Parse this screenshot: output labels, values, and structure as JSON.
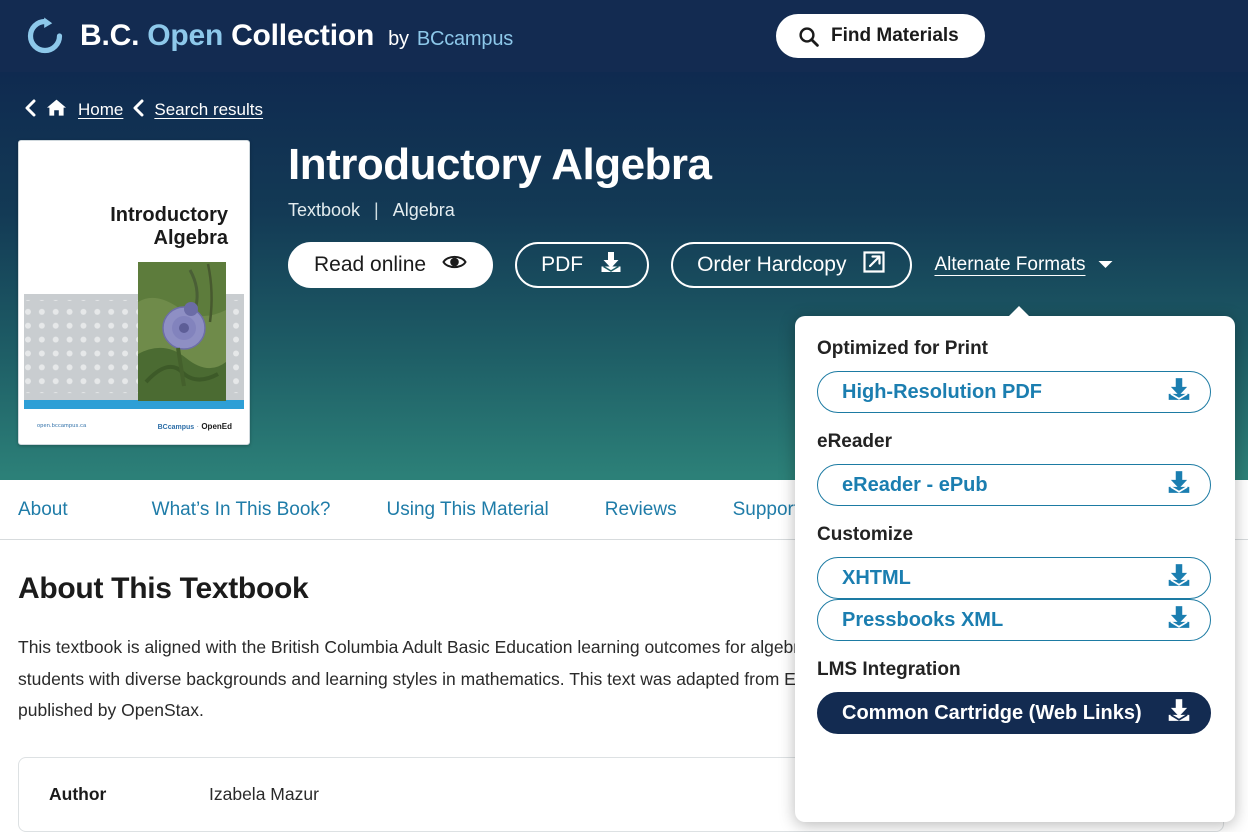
{
  "navbar": {
    "brand": {
      "part1": "B.C.",
      "part2": "Open",
      "part3": "Collection",
      "by": "by",
      "org": "BCcampus"
    },
    "find_materials_label": "Find Materials"
  },
  "breadcrumb": {
    "home_label": "Home",
    "search_results_label": "Search results"
  },
  "cover": {
    "title_line1": "Introductory",
    "title_line2": "Algebra",
    "footer_left": "open.bccampus.ca",
    "footer_right_brand": "BCcampus",
    "footer_right_sep": "·",
    "footer_right_name": "OpenEd"
  },
  "hero": {
    "title": "Introductory Algebra",
    "type_label": "Textbook",
    "separator": "|",
    "subject_label": "Algebra",
    "actions": {
      "read_online": "Read online",
      "pdf": "PDF",
      "order_hardcopy": "Order Hardcopy",
      "alternate_formats": "Alternate Formats"
    }
  },
  "tabs": [
    {
      "label": "About"
    },
    {
      "label": "What’s In This Book?"
    },
    {
      "label": "Using This Material"
    },
    {
      "label": "Reviews"
    },
    {
      "label": "Supporting Material"
    }
  ],
  "content": {
    "heading": "About This Textbook",
    "paragraph": "This textbook is aligned with the British Columbia Adult Basic Education learning outcomes for algebra and trigonometry while addressing the needs of students with diverse backgrounds and learning styles in mathematics. This text was adapted from Elementary Algebra and Prealgebra, textbooks originally published by OpenStax.",
    "meta": {
      "author_label": "Author",
      "author_value": "Izabela Mazur"
    }
  },
  "dropdown": {
    "sections": [
      {
        "heading": "Optimized for Print",
        "items": [
          {
            "label": "High-Resolution PDF",
            "style": "outline"
          }
        ]
      },
      {
        "heading": "eReader",
        "items": [
          {
            "label": "eReader - ePub",
            "style": "outline"
          }
        ]
      },
      {
        "heading": "Customize",
        "items": [
          {
            "label": "XHTML",
            "style": "outline"
          },
          {
            "label": "Pressbooks XML",
            "style": "outline"
          }
        ]
      },
      {
        "heading": "LMS Integration",
        "items": [
          {
            "label": "Common Cartridge (Web Links)",
            "style": "solid"
          }
        ]
      }
    ]
  },
  "colors": {
    "navy": "#132b51",
    "teal": "#2c8078",
    "link_blue": "#1f7ca8",
    "accent_light_blue": "#8dc8ea",
    "dropdown_border": "#1d7ba3"
  }
}
